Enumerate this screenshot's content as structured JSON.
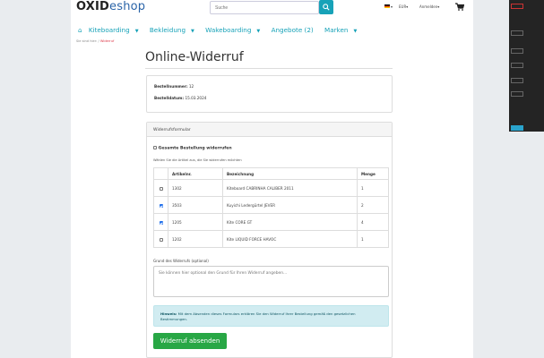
{
  "header": {
    "logo_a": "OXID",
    "logo_b": "eshop",
    "search_placeholder": "Suche",
    "currency": "EUR",
    "account": "Anmelden"
  },
  "nav": {
    "items": [
      "Kiteboarding",
      "Bekleidung",
      "Wakeboarding",
      "Angebote (2)",
      "Marken"
    ]
  },
  "breadcrumb": {
    "prefix": "Sie sind hier:",
    "sep": "/",
    "current": "Widerruf"
  },
  "page_title": "Online-Widerruf",
  "order": {
    "number_label": "Bestellnummer:",
    "number": "12",
    "date_label": "Bestelldatum:",
    "date": "15.03.2024"
  },
  "form": {
    "title": "Widerrufsformular",
    "all_label": "Gesamte Bestellung widerrufen",
    "hint": "Wählen Sie die Artikel aus, die Sie widerrufen möchten",
    "columns": [
      "Artikelnr.",
      "Bezeichnung",
      "Menge"
    ],
    "rows": [
      {
        "checked": false,
        "artnum": "1302",
        "title": "Kiteboard CABRINHA CALIBER 2011",
        "qty": "1"
      },
      {
        "checked": true,
        "artnum": "3503",
        "title": "Kuyichi Ledergürtel JEVER",
        "qty": "2"
      },
      {
        "checked": true,
        "artnum": "1205",
        "title": "Kite CORE GT",
        "qty": "4"
      },
      {
        "checked": false,
        "artnum": "1202",
        "title": "Kite LIQUID FORCE HAVOC",
        "qty": "1"
      }
    ],
    "reason_label": "Grund des Widerrufs (optional)",
    "reason_placeholder": "Sie können hier optional den Grund für Ihren Widerruf angeben...",
    "notice_bold": "Hinweis:",
    "notice_text": "Mit dem Absenden dieses Formulars erklären Sie den Widerruf Ihrer Bestellung gemäß den gesetzlichen Bestimmungen.",
    "submit_label": "Widerruf absenden"
  }
}
